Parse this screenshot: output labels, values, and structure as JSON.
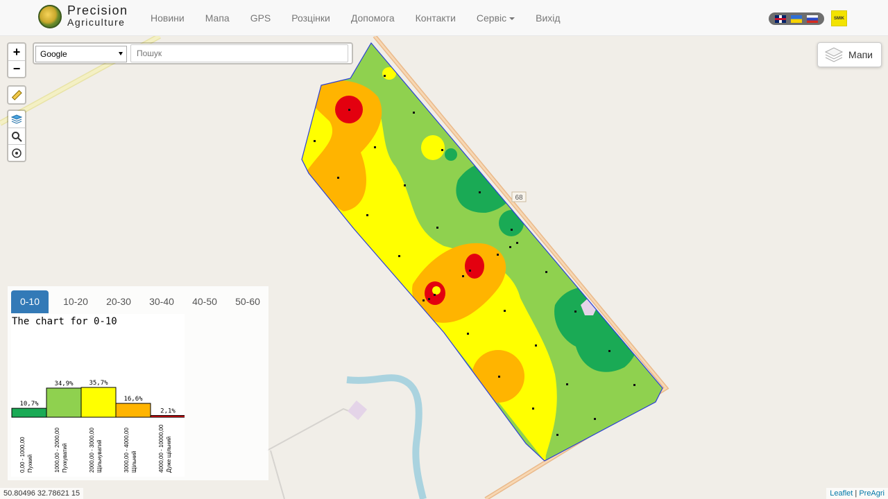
{
  "brand": {
    "line1": "Precision",
    "line2": "Agriculture"
  },
  "nav": [
    {
      "label": "Новини"
    },
    {
      "label": "Мапа"
    },
    {
      "label": "GPS"
    },
    {
      "label": "Розцінки"
    },
    {
      "label": "Допомога"
    },
    {
      "label": "Контакти"
    },
    {
      "label": "Сервіс",
      "dropdown": true
    },
    {
      "label": "Вихід"
    }
  ],
  "languages": [
    "en",
    "uk",
    "ru"
  ],
  "partner_logo_text": "SMIK",
  "map_controls": {
    "zoom_in": "+",
    "zoom_out": "−"
  },
  "search": {
    "provider": "Google",
    "placeholder": "Пошук"
  },
  "layers": {
    "label": "Мапи"
  },
  "road_label": "68",
  "tabs": [
    {
      "label": "0-10",
      "active": true
    },
    {
      "label": "10-20"
    },
    {
      "label": "20-30"
    },
    {
      "label": "30-40"
    },
    {
      "label": "40-50"
    },
    {
      "label": "50-60"
    }
  ],
  "chart_data": {
    "type": "bar",
    "title": "The chart for 0-10",
    "categories": [
      "0,00 - 1000,00 Пухкий",
      "1000,00 - 2000,00 Пухкуватий",
      "2000,00 - 3000,00 Щільнуватий",
      "3000,00 - 4000,00 Щільний",
      "4000,00 - 10000,00 Дуже щільний"
    ],
    "category_ranges": [
      "0,00 - 1000,00",
      "1000,00 - 2000,00",
      "2000,00 - 3000,00",
      "3000,00 - 4000,00",
      "4000,00 - 10000,00"
    ],
    "category_names": [
      "Пухкий",
      "Пухкуватий",
      "Щільнуватий",
      "Щільний",
      "Дуже щільний"
    ],
    "values": [
      10.7,
      34.9,
      35.7,
      16.6,
      2.1
    ],
    "value_labels": [
      "10,7%",
      "34,9%",
      "35,7%",
      "16,6%",
      "2,1%"
    ],
    "colors": [
      "#1aaa55",
      "#8fd14f",
      "#ffff00",
      "#ffb400",
      "#e3000f"
    ],
    "ylim": [
      0,
      35.7
    ]
  },
  "coords": "50.80496 32.78621 15",
  "attribution": {
    "leaflet": "Leaflet",
    "sep": "|",
    "preagri": "PreAgri"
  }
}
